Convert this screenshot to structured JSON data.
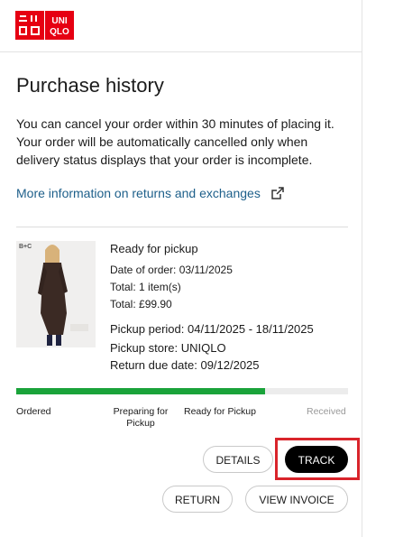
{
  "header": {
    "logo_left": "ユニ\nクロ",
    "logo_right": "UNI\nQLO",
    "brand_color": "#e60012"
  },
  "page": {
    "title": "Purchase history",
    "notice_line1": "You can cancel your order within 30 minutes of placing it.",
    "notice_line2": "Your order will be automatically cancelled only when",
    "notice_line3": "delivery status displays that your order is incomplete.",
    "returns_link": "More information on returns and exchanges",
    "link_icon": "external-link-icon"
  },
  "order": {
    "thumb_brand": "B+C",
    "status": "Ready for pickup",
    "date_of_order": "Date of order: 03/11/2025",
    "total_items": "Total: 1 item(s)",
    "total_price": "Total: £99.90",
    "pickup_period": "Pickup period: 04/11/2025 - 18/11/2025",
    "pickup_store": "Pickup store: UNIQLO",
    "return_due": "Return due date: 09/12/2025"
  },
  "progress": {
    "fraction": 0.75,
    "fill_color": "#1aa33a",
    "steps": [
      "Ordered",
      "Preparing for Pickup",
      "Ready for Pickup",
      "Received"
    ]
  },
  "actions": {
    "details": "DETAILS",
    "track": "TRACK",
    "return": "RETURN",
    "view_invoice": "VIEW INVOICE"
  }
}
